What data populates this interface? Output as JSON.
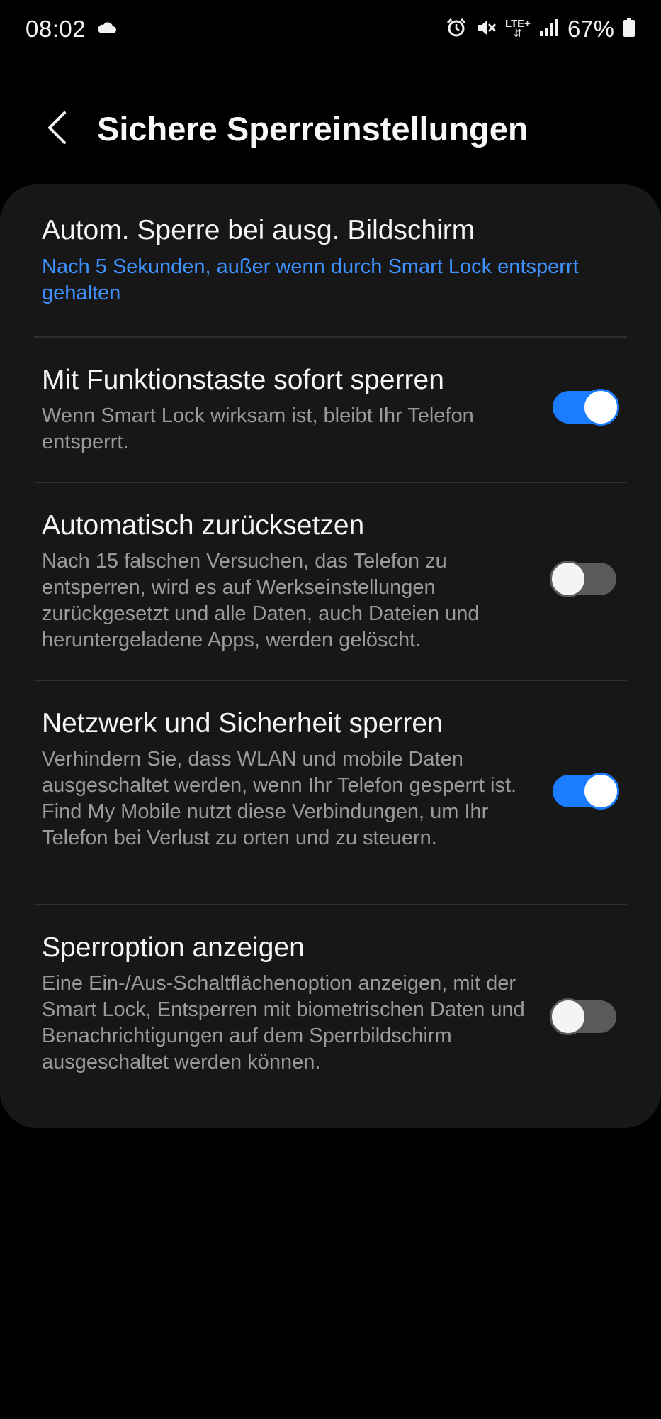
{
  "status_bar": {
    "time": "08:02",
    "weather_icon": "cloud-icon",
    "lte_top": "LTE+",
    "battery_percent": "67%"
  },
  "header": {
    "title": "Sichere Sperreinstellungen",
    "back_icon": "chevron-left-icon"
  },
  "settings": [
    {
      "title": "Autom. Sperre bei ausg. Bildschirm",
      "subtitle": "Nach 5 Sekunden, außer wenn durch Smart Lock entsperrt gehalten",
      "has_toggle": false
    },
    {
      "title": "Mit Funktionstaste sofort sperren",
      "subtitle": "Wenn Smart Lock wirksam ist, bleibt Ihr Telefon entsperrt.",
      "has_toggle": true,
      "enabled": true
    },
    {
      "title": "Automatisch zurücksetzen",
      "subtitle": "Nach 15 falschen Versuchen, das Telefon zu entsperren, wird es auf Werkseinstellungen zurückgesetzt und alle Daten, auch Dateien und heruntergeladene Apps, werden gelöscht.",
      "has_toggle": true,
      "enabled": false
    },
    {
      "title": "Netzwerk und Sicherheit sperren",
      "subtitle": "Verhindern Sie, dass WLAN und mobile Daten ausgeschaltet werden, wenn Ihr Telefon gesperrt ist. Find My Mobile nutzt diese Verbindungen, um Ihr Telefon bei Verlust zu orten und zu steuern.",
      "has_toggle": true,
      "enabled": true
    },
    {
      "title": "Sperroption anzeigen",
      "subtitle": "Eine Ein-/Aus-Schaltflächenoption anzeigen, mit der Smart Lock, Entsperren mit biometrischen Daten und Benachrichtigungen auf dem Sperrbildschirm ausgeschaltet werden können.",
      "has_toggle": true,
      "enabled": false
    }
  ],
  "colors": {
    "accent": "#3e91ff",
    "toggle_on": "#1a7cff",
    "toggle_off": "#5a5a5a",
    "card_bg": "#171717",
    "background": "#000000"
  }
}
